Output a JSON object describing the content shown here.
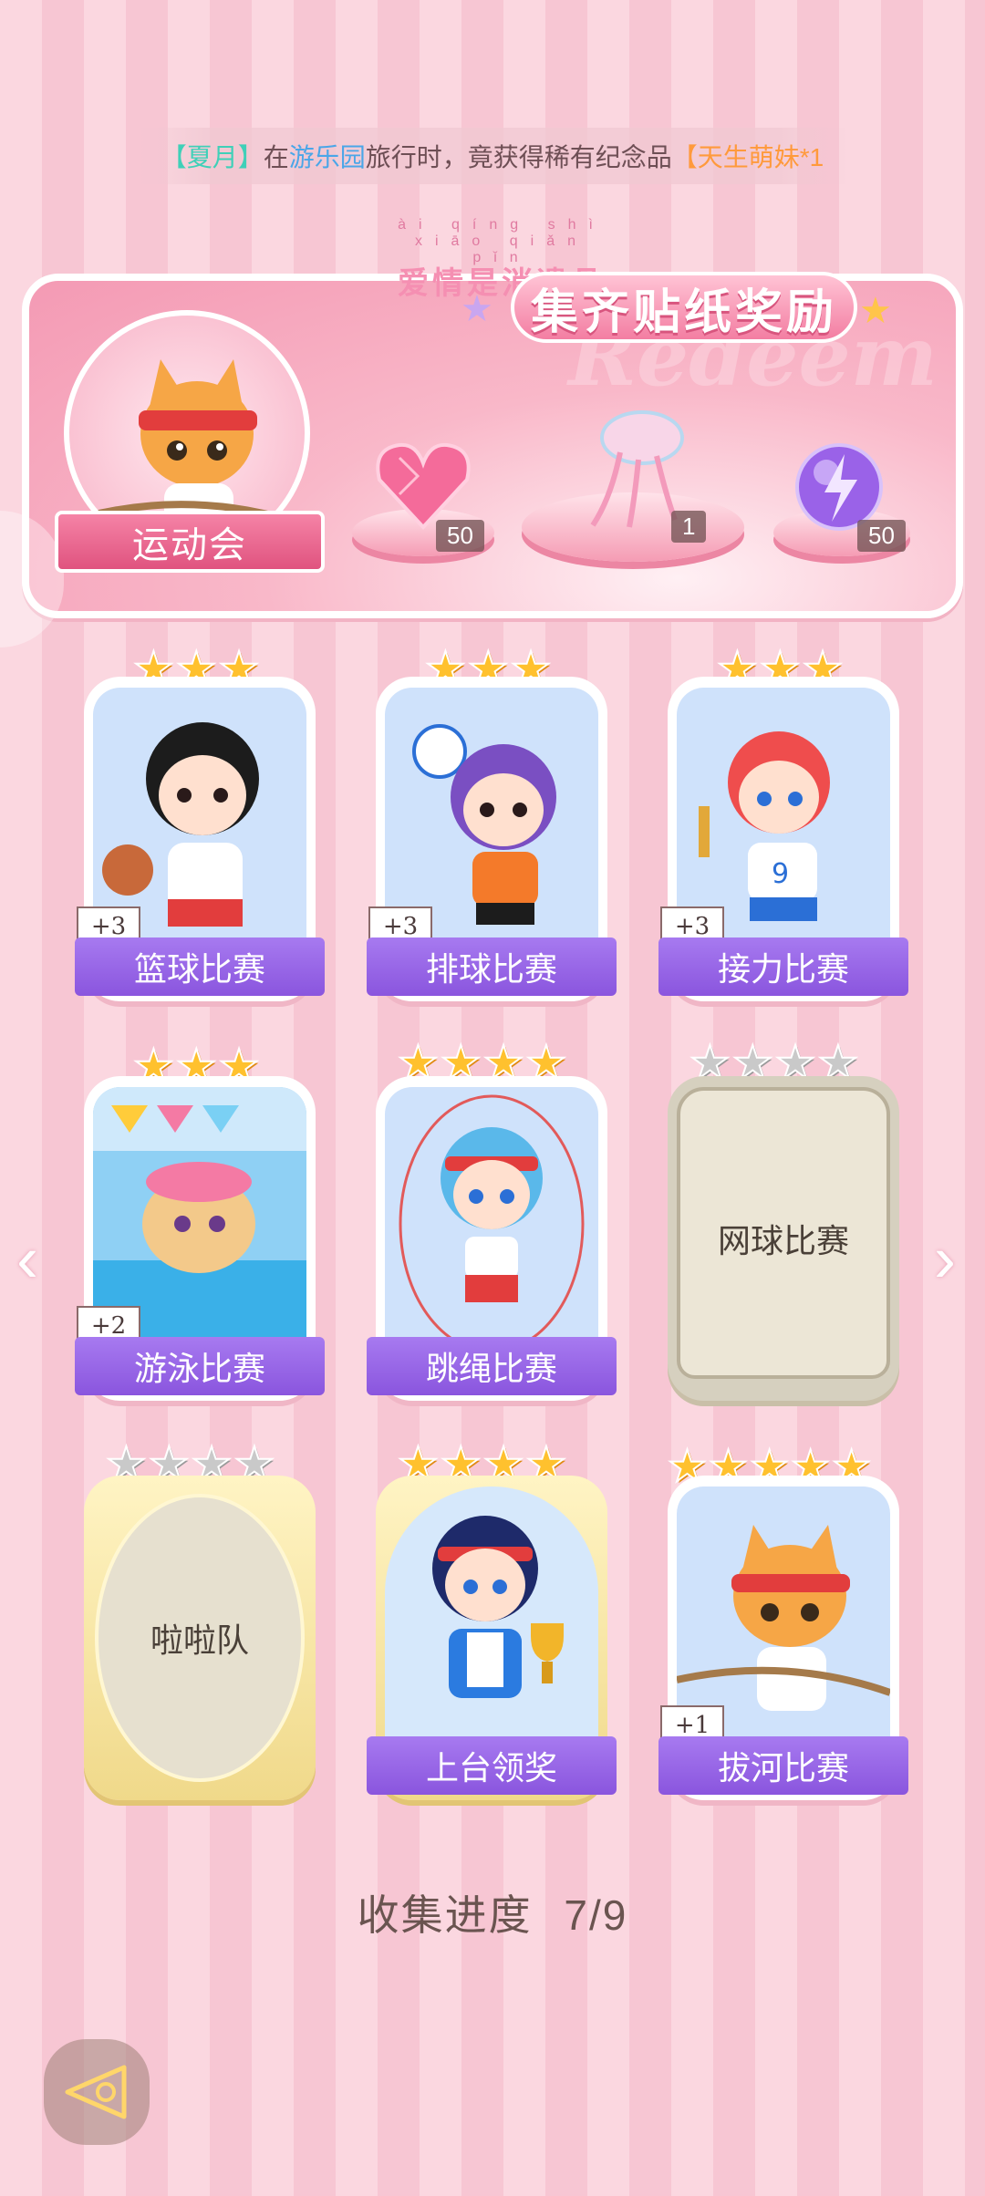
{
  "ticker": {
    "name": "【夏月】",
    "part1": "在",
    "place": "游乐园",
    "part2": "旅行时，竟获得稀有纪念品",
    "item": "【天生萌妹*1"
  },
  "banner": {
    "pinyin": "ài qíng shì xiāo qiǎn pǐn",
    "subtitle": "爱情是消遣品",
    "title": "集齐贴纸奖励",
    "watermark": "Redeem",
    "event_name": "运动会",
    "rewards": [
      {
        "icon": "pink-heart-gem-icon",
        "count": "50"
      },
      {
        "icon": "jellyfish-bouquet-icon",
        "count": "1"
      },
      {
        "icon": "purple-lightning-orb-icon",
        "count": "50"
      }
    ]
  },
  "cards": [
    {
      "label": "篮球比赛",
      "bonus": "+3",
      "stars": 3,
      "max_stars": 3,
      "state": "unlocked",
      "art": "basketball-girl"
    },
    {
      "label": "排球比赛",
      "bonus": "+3",
      "stars": 3,
      "max_stars": 3,
      "state": "unlocked",
      "art": "volleyball-girl"
    },
    {
      "label": "接力比赛",
      "bonus": "+3",
      "stars": 3,
      "max_stars": 3,
      "state": "unlocked",
      "art": "relay-girl"
    },
    {
      "label": "游泳比赛",
      "bonus": "+2",
      "stars": 3,
      "max_stars": 3,
      "state": "unlocked",
      "art": "swimming-dog"
    },
    {
      "label": "跳绳比赛",
      "bonus": "",
      "stars": 4,
      "max_stars": 4,
      "state": "unlocked",
      "art": "jumprope-girl"
    },
    {
      "label": "网球比赛",
      "bonus": "",
      "stars": 0,
      "max_stars": 4,
      "state": "locked",
      "art": ""
    },
    {
      "label": "啦啦队",
      "bonus": "",
      "stars": 0,
      "max_stars": 4,
      "state": "locked-gold",
      "art": ""
    },
    {
      "label": "上台领奖",
      "bonus": "",
      "stars": 4,
      "max_stars": 4,
      "state": "unlocked-gold",
      "art": "trophy-girl"
    },
    {
      "label": "拔河比赛",
      "bonus": "+1",
      "stars": 5,
      "max_stars": 5,
      "state": "unlocked",
      "art": "tug-of-war-cat"
    }
  ],
  "progress": {
    "label": "收集进度",
    "value": "7/9"
  },
  "nav": {
    "prev": "‹",
    "next": "›"
  },
  "colors": {
    "accent": "#f37ea2",
    "label_purple": "#8a55de",
    "star_gold": "#ffc12e",
    "background": "#fbd7e0"
  }
}
